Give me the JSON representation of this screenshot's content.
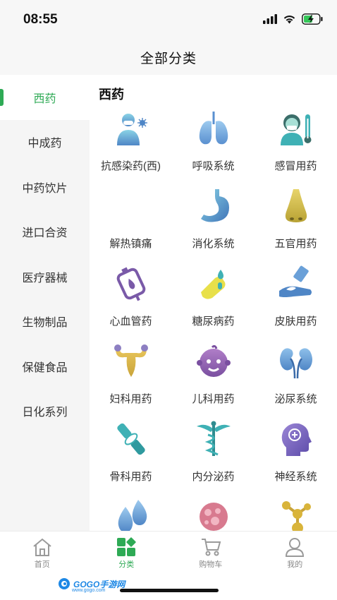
{
  "status_bar": {
    "time": "08:55"
  },
  "header": {
    "title": "全部分类"
  },
  "sidebar": {
    "items": [
      {
        "label": "西药",
        "active": true
      },
      {
        "label": "中成药",
        "active": false
      },
      {
        "label": "中药饮片",
        "active": false
      },
      {
        "label": "进口合资",
        "active": false
      },
      {
        "label": "医疗器械",
        "active": false
      },
      {
        "label": "生物制品",
        "active": false
      },
      {
        "label": "保健食品",
        "active": false
      },
      {
        "label": "日化系列",
        "active": false
      }
    ]
  },
  "content": {
    "section_title": "西药",
    "categories": [
      {
        "label": "抗感染药(西)",
        "icon": "doctor-virus-icon"
      },
      {
        "label": "呼吸系统",
        "icon": "lungs-icon"
      },
      {
        "label": "感冒用药",
        "icon": "thermometer-person-icon"
      },
      {
        "label": "解热镇痛",
        "icon": "none"
      },
      {
        "label": "消化系统",
        "icon": "stomach-icon"
      },
      {
        "label": "五官用药",
        "icon": "nose-icon"
      },
      {
        "label": "心血管药",
        "icon": "blood-bag-icon"
      },
      {
        "label": "糖尿病药",
        "icon": "finger-drop-icon"
      },
      {
        "label": "皮肤用药",
        "icon": "hand-cream-icon"
      },
      {
        "label": "妇科用药",
        "icon": "uterus-icon"
      },
      {
        "label": "儿科用药",
        "icon": "baby-icon"
      },
      {
        "label": "泌尿系统",
        "icon": "kidneys-icon"
      },
      {
        "label": "骨科用药",
        "icon": "bone-joint-icon"
      },
      {
        "label": "内分泌药",
        "icon": "caduceus-icon"
      },
      {
        "label": "神经系统",
        "icon": "head-brain-icon"
      },
      {
        "label": "",
        "icon": "water-drops-icon"
      },
      {
        "label": "",
        "icon": "cell-icon"
      },
      {
        "label": "",
        "icon": "molecule-icon"
      }
    ]
  },
  "tabbar": {
    "tabs": [
      {
        "label": "首页",
        "icon": "home-icon",
        "active": false
      },
      {
        "label": "分类",
        "icon": "category-icon",
        "active": true
      },
      {
        "label": "购物车",
        "icon": "cart-icon",
        "active": false
      },
      {
        "label": "我的",
        "icon": "user-icon",
        "active": false
      }
    ]
  },
  "watermark": {
    "text": "GOGO手游网",
    "sub": "www.gogo.com"
  },
  "colors": {
    "accent": "#2eaa55",
    "teal": "#3fb1b5",
    "blue": "#4f86c6",
    "purple": "#7a5aa8",
    "gold": "#d9b43a",
    "pink": "#d87a8f"
  }
}
